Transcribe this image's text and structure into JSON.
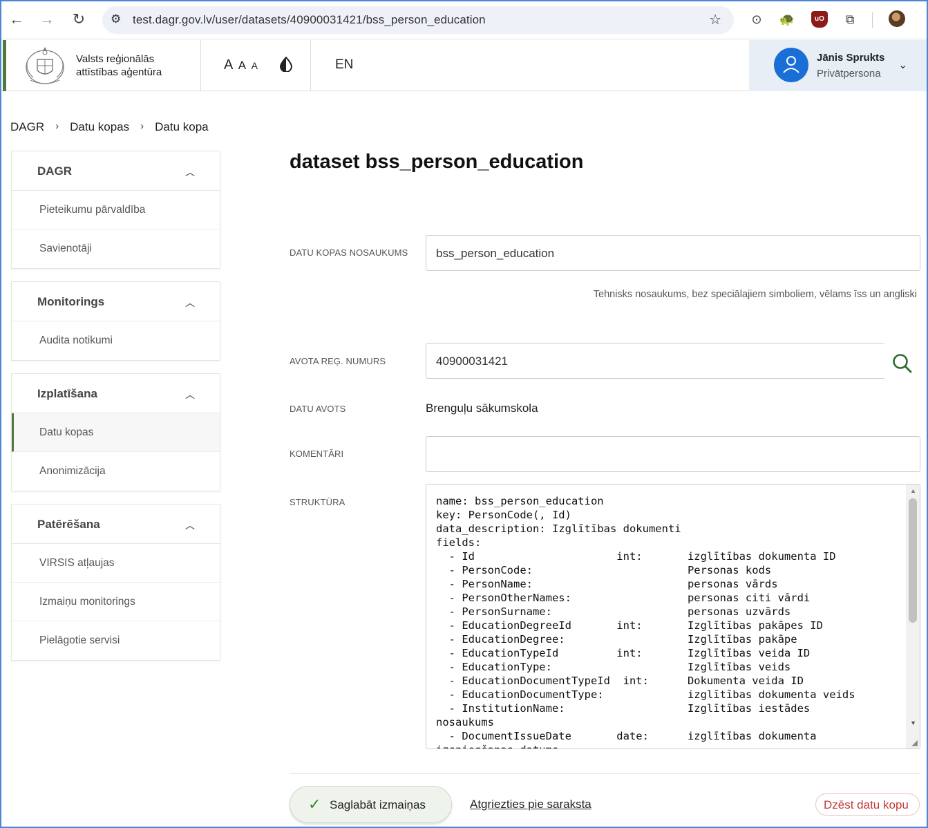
{
  "browser": {
    "url": "test.dagr.gov.lv/user/datasets/40900031421/bss_person_education"
  },
  "header": {
    "agency_line1": "Valsts reģionālās",
    "agency_line2": "attīstības aģentūra",
    "font_sizes": [
      "A",
      "A",
      "A"
    ],
    "language": "EN",
    "user_name": "Jānis Sprukts",
    "user_role": "Privātpersona"
  },
  "breadcrumb": [
    "DAGR",
    "Datu kopas",
    "Datu kopa"
  ],
  "sidebar": {
    "groups": [
      {
        "title": "DAGR",
        "items": [
          "Pieteikumu pārvaldība",
          "Savienotāji"
        ]
      },
      {
        "title": "Monitorings",
        "items": [
          "Audita notikumi"
        ]
      },
      {
        "title": "Izplatīšana",
        "items": [
          "Datu kopas",
          "Anonimizācija"
        ]
      },
      {
        "title": "Patērēšana",
        "items": [
          "VIRSIS atļaujas",
          "Izmaiņu monitorings",
          "Pielāgotie servisi"
        ]
      }
    ],
    "active_item": "Datu kopas"
  },
  "main": {
    "title": "dataset bss_person_education",
    "fields": {
      "name_label": "DATU KOPAS NOSAUKUMS",
      "name_value": "bss_person_education",
      "name_hint": "Tehnisks nosaukums, bez speciālajiem simboliem, vēlams īss un angliski",
      "reg_label": "AVOTA REĢ. NUMURS",
      "reg_value": "40900031421",
      "source_label": "DATU AVOTS",
      "source_value": "Brenguļu sākumskola",
      "comments_label": "KOMENTĀRI",
      "comments_value": "",
      "structure_label": "STRUKTŪRA",
      "structure_value": "name: bss_person_education\nkey: PersonCode(, Id)\ndata_description: Izglītības dokumenti\nfields:\n  - Id                      int:       izglītības dokumenta ID\n  - PersonCode:                        Personas kods\n  - PersonName:                        personas vārds\n  - PersonOtherNames:                  personas citi vārdi\n  - PersonSurname:                     personas uzvārds\n  - EducationDegreeId       int:       Izglītības pakāpes ID\n  - EducationDegree:                   Izglītības pakāpe\n  - EducationTypeId         int:       Izglītības veida ID\n  - EducationType:                     Izglītības veids\n  - EducationDocumentTypeId  int:      Dokumenta veida ID\n  - EducationDocumentType:             izglītības dokumenta veids\n  - InstitutionName:                   Izglītības iestādes\nnosaukums\n  - DocumentIssueDate       date:      izglītības dokumenta\nizsniegšanas datums"
    },
    "actions": {
      "save": "Saglabāt izmaiņas",
      "back": "Atgriezties pie saraksta",
      "delete": "Dzēst datu kopu"
    }
  },
  "colors": {
    "accent_green": "#4f7a3c",
    "user_blue": "#1a6fd6",
    "delete_red": "#c43a3a"
  }
}
